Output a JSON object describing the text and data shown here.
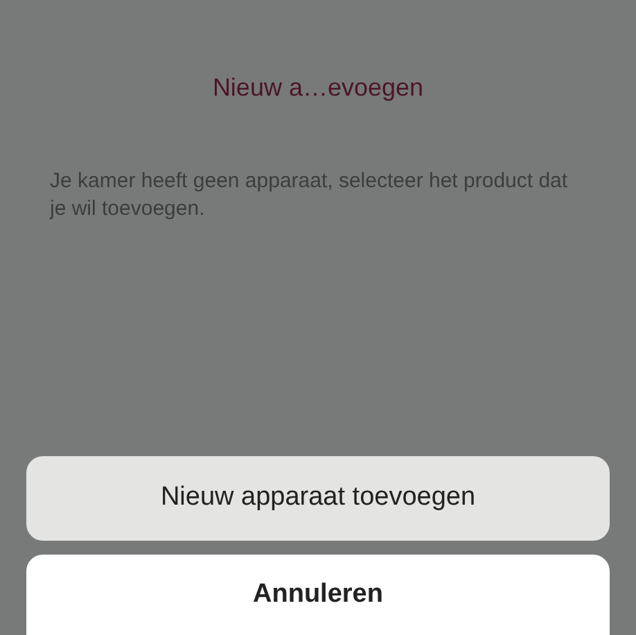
{
  "screen": {
    "title": "Nieuw a…evoegen",
    "message": "Je kamer heeft geen apparaat, selecteer het product dat je wil toevoegen."
  },
  "action_sheet": {
    "actions": [
      "Nieuw apparaat toevoegen"
    ],
    "cancel": "Annuleren"
  }
}
